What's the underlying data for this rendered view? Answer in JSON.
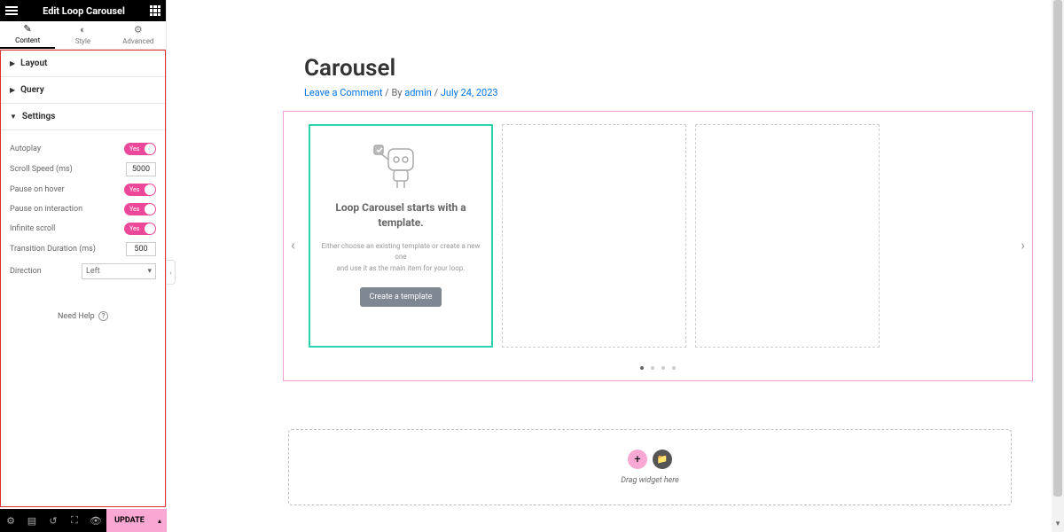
{
  "header": {
    "title": "Edit Loop Carousel"
  },
  "tabs": {
    "content": "Content",
    "style": "Style",
    "advanced": "Advanced"
  },
  "sections": {
    "layout": "Layout",
    "query": "Query",
    "settings": "Settings"
  },
  "controls": {
    "autoplay": {
      "label": "Autoplay",
      "value": "Yes"
    },
    "scroll_speed": {
      "label": "Scroll Speed (ms)",
      "value": "5000"
    },
    "pause_hover": {
      "label": "Pause on hover",
      "value": "Yes"
    },
    "pause_interaction": {
      "label": "Pause on interaction",
      "value": "Yes"
    },
    "infinite": {
      "label": "Infinite scroll",
      "value": "Yes"
    },
    "transition": {
      "label": "Transition Duration (ms)",
      "value": "500"
    },
    "direction": {
      "label": "Direction",
      "value": "Left"
    }
  },
  "help": {
    "text": "Need Help"
  },
  "footer": {
    "update": "UPDATE"
  },
  "page": {
    "title": "Carousel",
    "leave_comment": "Leave a Comment",
    "by": " / By ",
    "author": "admin",
    "date_sep": " / ",
    "date": "July 24, 2023"
  },
  "slide": {
    "title_l1": "Loop Carousel starts with a",
    "title_l2": "template.",
    "desc_l1": "Either choose an existing template or create a new one",
    "desc_l2": "and use it as the main item for your loop.",
    "button": "Create a template"
  },
  "dropzone": {
    "text": "Drag widget here"
  }
}
